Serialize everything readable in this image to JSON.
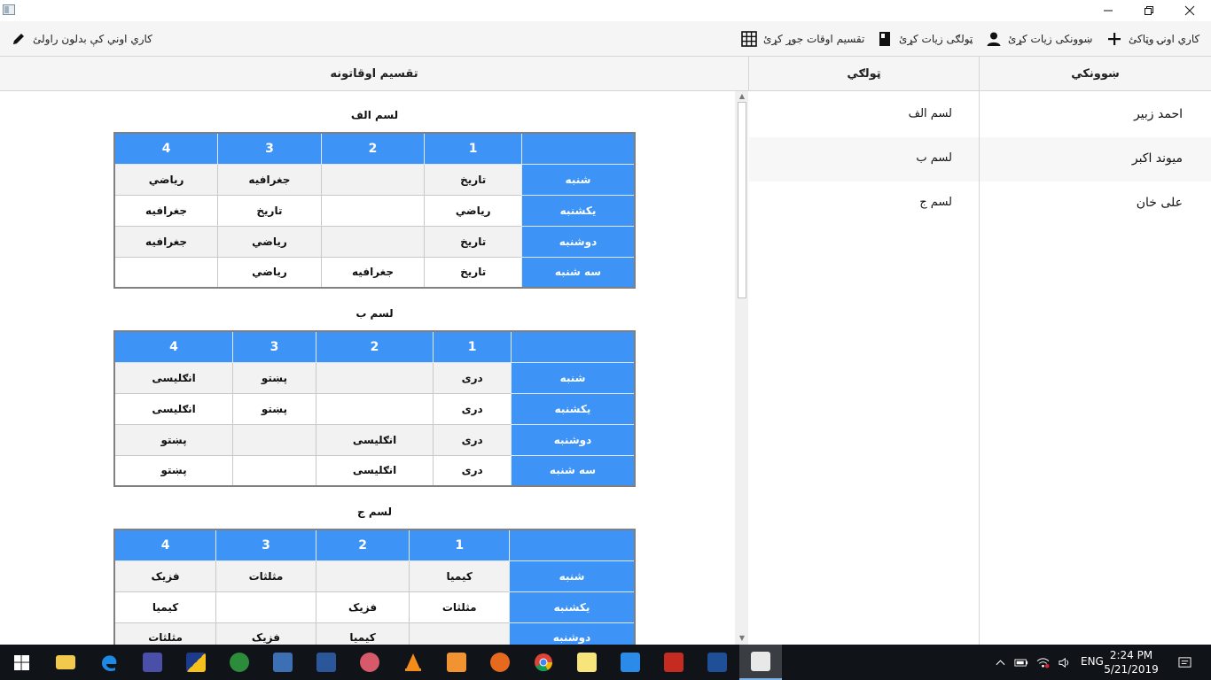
{
  "toolbar": {
    "edit_workplace": "کاري اوني کې بدلون راولئ",
    "add_work_hours": "کاري اونۍ وټاکئ",
    "add_student": "ښوونکی زيات کړئ",
    "add_class": "ټولګی زيات کړئ",
    "make_schedule": "تقسیم اوقات جوړ کړئ"
  },
  "headers": {
    "schedule": "تقسیم اوقاتونه",
    "class": "ټولګي",
    "teacher": "ښوونکي"
  },
  "days": [
    "شنبه",
    "یکشنبه",
    "دوشنبه",
    "سه شنبه"
  ],
  "periods": [
    "1",
    "2",
    "3",
    "4"
  ],
  "schedules": [
    {
      "title": "لسم الف",
      "rows": [
        [
          "تاریخ",
          "",
          "جغرافیه",
          "ریاضي"
        ],
        [
          "ریاضي",
          "",
          "تاريخ",
          "جغرافیه"
        ],
        [
          "تاریخ",
          "",
          "ریاضي",
          "جغرافیه"
        ],
        [
          "تاریخ",
          "جغرافیه",
          "ریاضي",
          ""
        ]
      ]
    },
    {
      "title": "لسم ب",
      "rows": [
        [
          "دری",
          "",
          "پښتو",
          "انګلیسی"
        ],
        [
          "دری",
          "",
          "پښتو",
          "انګلیسی"
        ],
        [
          "دری",
          "انګلیسی",
          "",
          "پښتو"
        ],
        [
          "دری",
          "انګلیسی",
          "",
          "پښتو"
        ]
      ]
    },
    {
      "title": "لسم ج",
      "rows": [
        [
          "کیمیا",
          "",
          "مثلثات",
          "فزیک"
        ],
        [
          "مثلثات",
          "فزیک",
          "",
          "کیمیا"
        ],
        [
          "",
          "کیمیا",
          "فزیک",
          "مثلثات"
        ]
      ]
    }
  ],
  "teachers": [
    {
      "name": "احمد زبیر",
      "class": "لسم الف"
    },
    {
      "name": "میوند اکبر",
      "class": "لسم ب"
    },
    {
      "name": "علی خان",
      "class": "لسم ج"
    }
  ],
  "tray": {
    "language": "ENG",
    "time": "2:24 PM",
    "date": "5/21/2019"
  },
  "colors": {
    "accent": "#3d94f6",
    "taskbar": "#101317"
  }
}
